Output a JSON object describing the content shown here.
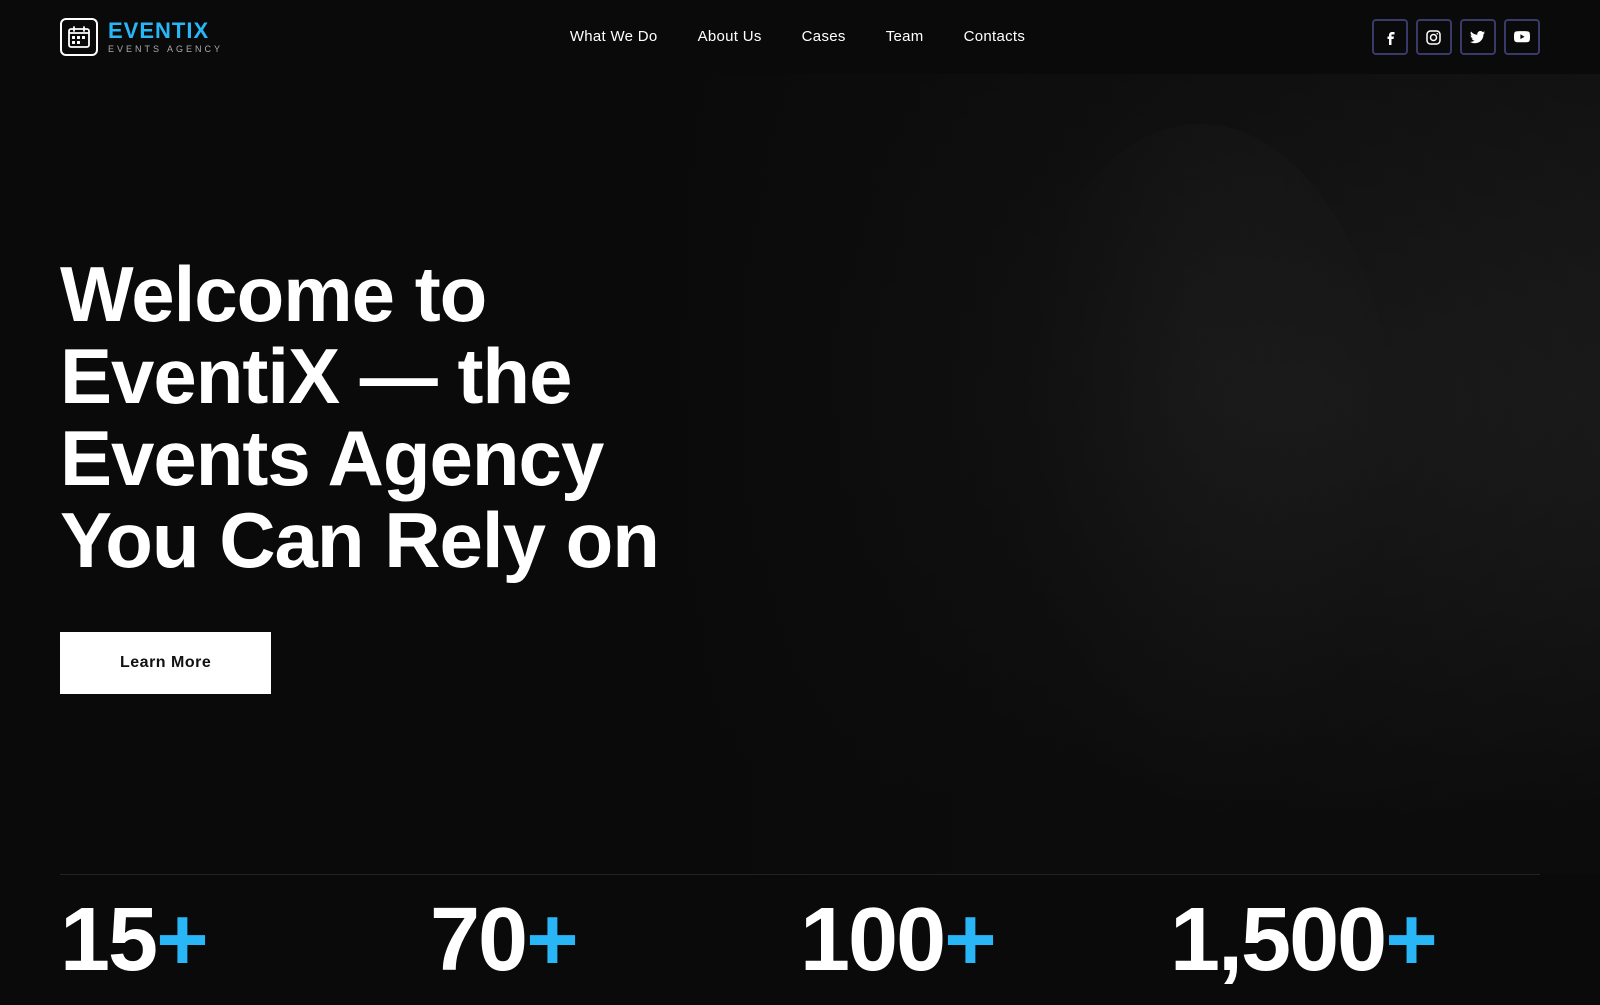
{
  "logo": {
    "name_prefix": "EVENTI",
    "name_suffix": "X",
    "tagline": "EVENTS AGENCY"
  },
  "nav": {
    "links": [
      {
        "label": "What We Do",
        "href": "#"
      },
      {
        "label": "About Us",
        "href": "#"
      },
      {
        "label": "Cases",
        "href": "#"
      },
      {
        "label": "Team",
        "href": "#"
      },
      {
        "label": "Contacts",
        "href": "#"
      }
    ]
  },
  "social": [
    {
      "name": "facebook-icon",
      "symbol": "f"
    },
    {
      "name": "instagram-icon",
      "symbol": "◻"
    },
    {
      "name": "twitter-icon",
      "symbol": "t"
    },
    {
      "name": "youtube-icon",
      "symbol": "▶"
    }
  ],
  "hero": {
    "title_line1": "Welcome to",
    "title_line2": "EventiX — the",
    "title_line3": "Events Agency",
    "title_line4": "You Can Rely on",
    "cta_label": "Learn More"
  },
  "stats": [
    {
      "number": "15",
      "suffix": "+",
      "label": ""
    },
    {
      "number": "70",
      "suffix": "+",
      "label": ""
    },
    {
      "number": "100",
      "suffix": "+",
      "label": ""
    },
    {
      "number": "1,500",
      "suffix": "+",
      "label": ""
    }
  ]
}
